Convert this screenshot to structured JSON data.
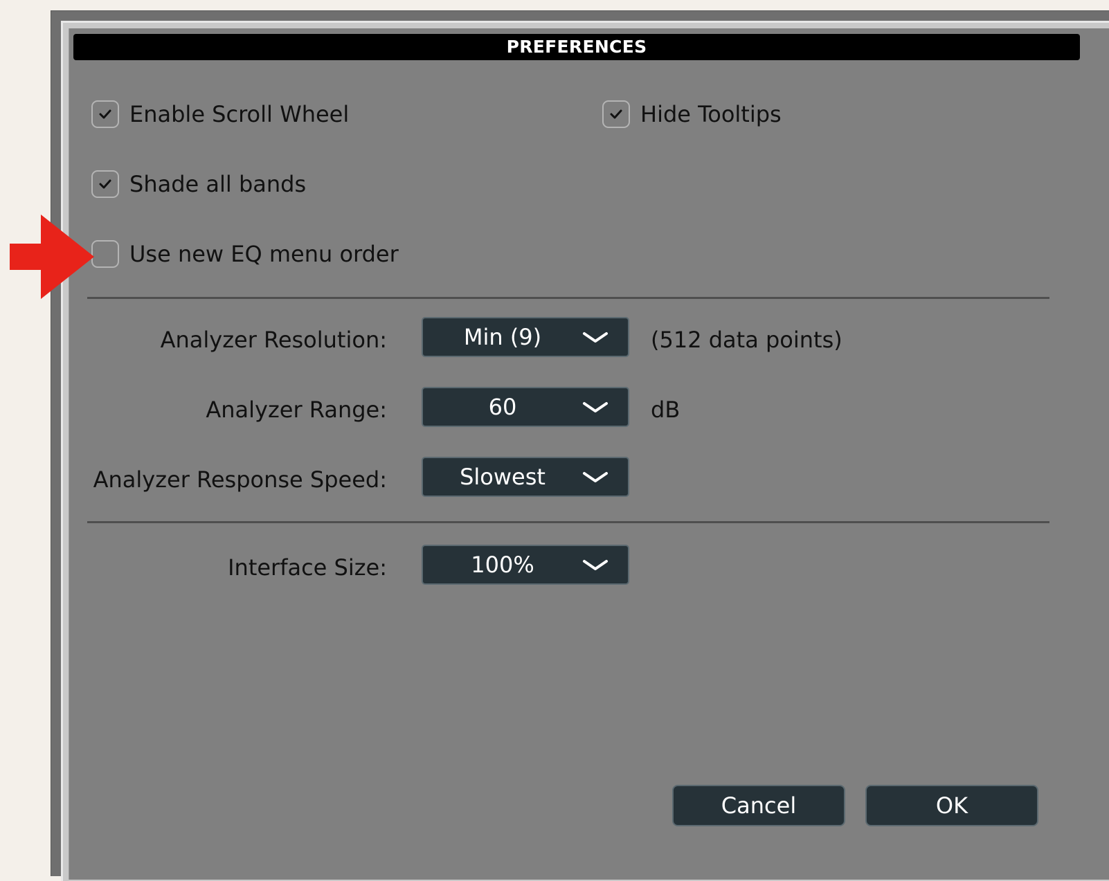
{
  "dialog": {
    "title": "PREFERENCES"
  },
  "checkboxes": {
    "scroll_wheel": {
      "label": "Enable Scroll Wheel",
      "checked": true
    },
    "hide_tooltips": {
      "label": "Hide Tooltips",
      "checked": true
    },
    "shade_bands": {
      "label": "Shade all bands",
      "checked": true
    },
    "eq_menu_order": {
      "label": "Use new EQ menu order",
      "checked": false
    }
  },
  "settings": {
    "resolution": {
      "label": "Analyzer Resolution:",
      "value": "Min (9)",
      "suffix": "(512 data points)"
    },
    "range": {
      "label": "Analyzer Range:",
      "value": "60",
      "suffix": "dB"
    },
    "speed": {
      "label": "Analyzer Response Speed:",
      "value": "Slowest"
    },
    "interface_size": {
      "label": "Interface Size:",
      "value": "100%"
    }
  },
  "buttons": {
    "cancel": "Cancel",
    "ok": "OK"
  },
  "annotation": {
    "arrow_color": "#e8231a",
    "icon": "red-arrow-icon"
  },
  "colors": {
    "dialog_bg": "#808080",
    "control_bg": "#263238",
    "title_bg": "#000000"
  }
}
